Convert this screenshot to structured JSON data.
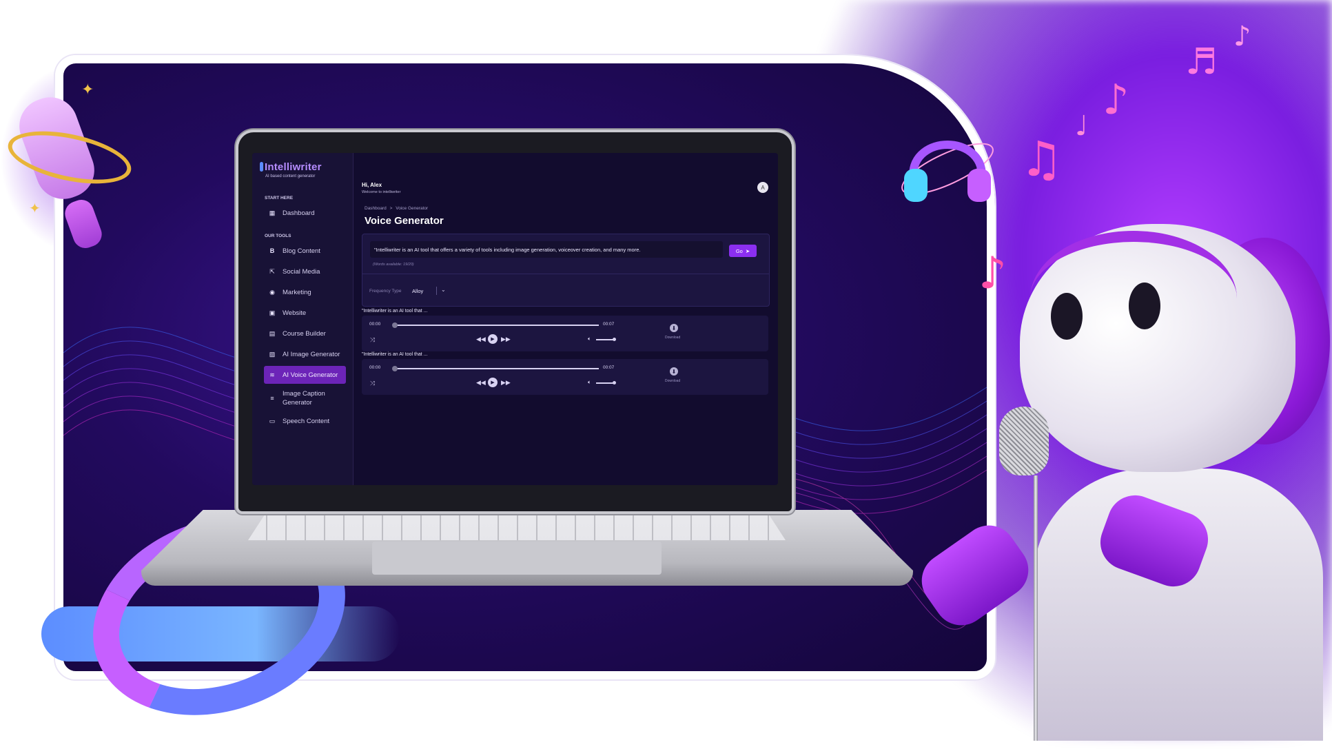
{
  "app": {
    "brand": "Intelliwriter",
    "tagline": "AI based content generator"
  },
  "sidebar": {
    "start_label": "START HERE",
    "tools_label": "OUR TOOLS",
    "dashboard": {
      "label": "Dashboard",
      "icon": "grid-icon"
    },
    "items": [
      {
        "label": "Blog Content",
        "icon": "blog-icon"
      },
      {
        "label": "Social Media",
        "icon": "share-icon"
      },
      {
        "label": "Marketing",
        "icon": "target-icon"
      },
      {
        "label": "Website",
        "icon": "browser-icon"
      },
      {
        "label": "Course Builder",
        "icon": "book-icon"
      },
      {
        "label": "AI Image Generator",
        "icon": "image-icon"
      },
      {
        "label": "AI Voice Generator",
        "icon": "waveform-icon",
        "active": true
      },
      {
        "label": "Image Caption Generator",
        "icon": "caption-icon"
      },
      {
        "label": "Speech Content",
        "icon": "chat-icon"
      }
    ]
  },
  "header": {
    "greeting": "Hi, Alex",
    "welcome": "Welcome to intelliwriter",
    "avatar_initial": "A"
  },
  "breadcrumb": {
    "root": "Dashboard",
    "separator": ">",
    "current": "Voice Generator"
  },
  "page": {
    "title": "Voice Generator"
  },
  "generator": {
    "prompt_text": "\"Intelliwriter is an AI tool that offers a variety of tools including image generation, voiceover creation, and many more.",
    "go_label": "Go",
    "words_available": "(Words available: 19/20)",
    "frequency_label": "Frequency Type",
    "frequency_value": "Alloy"
  },
  "tracks": [
    {
      "title": "\"Intelliwriter is an AI tool that ...",
      "time_start": "00:00",
      "time_end": "00:07",
      "download_label": "Download",
      "progress": 0,
      "volume": 1
    },
    {
      "title": "\"Intelliwriter is an AI tool that ...",
      "time_start": "00:00",
      "time_end": "00:07",
      "download_label": "Download",
      "progress": 0,
      "volume": 1
    }
  ],
  "colors": {
    "accent": "#8b2ff0",
    "active_nav": "#6c24b8",
    "screen_bg": "#120c2e",
    "sidebar_bg": "#181236",
    "card_bg": "#1c1540"
  }
}
